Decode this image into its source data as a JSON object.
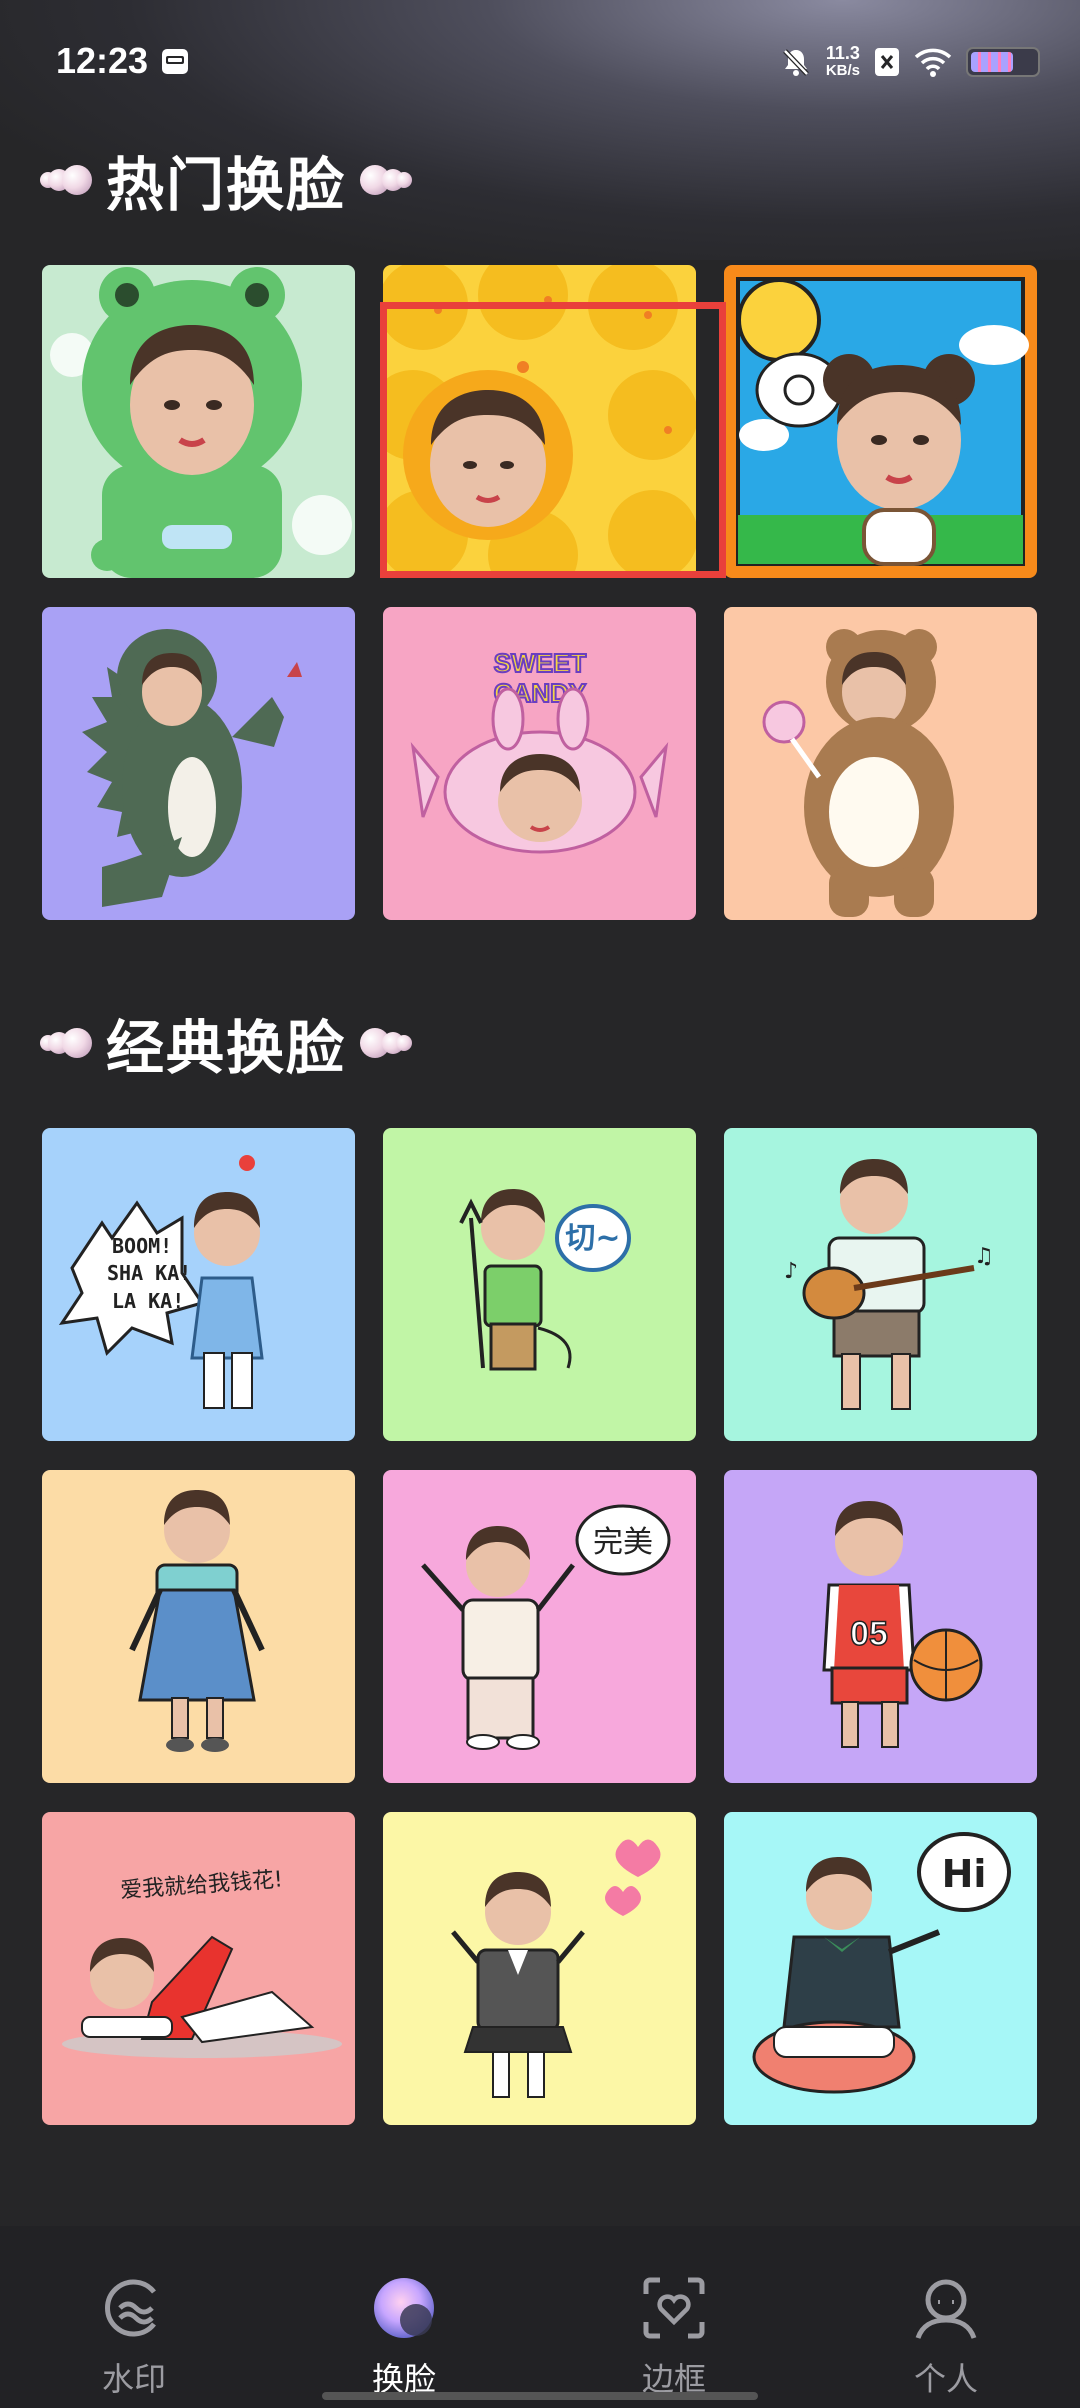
{
  "status_bar": {
    "time": "12:23",
    "net_speed_value": "11.3",
    "net_speed_unit": "KB/s",
    "battery_level": 0.68,
    "icons": [
      "calendar-icon",
      "mute-bell-icon",
      "sim-x-icon",
      "wifi-icon",
      "battery-icon"
    ]
  },
  "sections": [
    {
      "title": "热门换脸",
      "items": [
        {
          "name": "frog-hood",
          "bg": "#c7ead0"
        },
        {
          "name": "duck-hood",
          "bg": "#fbd23d"
        },
        {
          "name": "bear-ears-comic",
          "bg": "#2aa8e6"
        },
        {
          "name": "dinosaur-costume",
          "bg": "#a9a1f5"
        },
        {
          "name": "sweet-candy",
          "bg": "#f7a5c4",
          "text": "SWEET CANDY"
        },
        {
          "name": "teddy-bear-costume",
          "bg": "#fcc8a6"
        }
      ]
    },
    {
      "title": "经典换脸",
      "items": [
        {
          "name": "boom-shaka",
          "bg": "#a6d2fb",
          "text": "BOOM! SHA KA! LA KA!"
        },
        {
          "name": "devil-qie",
          "bg": "#c1f5a6",
          "text": "切~"
        },
        {
          "name": "guitar",
          "bg": "#a6f5df"
        },
        {
          "name": "overalls-girl",
          "bg": "#fcdca6"
        },
        {
          "name": "perfect",
          "bg": "#f7a8dc",
          "text": "完美"
        },
        {
          "name": "basketball",
          "bg": "#c5a6f7",
          "text": "05"
        },
        {
          "name": "lying-love",
          "bg": "#f7a5a5",
          "text": "爱我就给我钱花!"
        },
        {
          "name": "school-uniform",
          "bg": "#fcf7a6"
        },
        {
          "name": "hi-sitting",
          "bg": "#a6f7f7",
          "text": "Hi"
        }
      ]
    }
  ],
  "bottom_nav": {
    "items": [
      {
        "label": "水印",
        "icon": "watermark-icon",
        "active": false
      },
      {
        "label": "换脸",
        "icon": "faceswap-icon",
        "active": true
      },
      {
        "label": "边框",
        "icon": "frame-icon",
        "active": false
      },
      {
        "label": "个人",
        "icon": "person-icon",
        "active": false
      }
    ]
  },
  "colors": {
    "background": "#262628",
    "highlight": "#e9403b",
    "nav_active": "#ffffff",
    "nav_inactive": "#9c9ca2"
  }
}
